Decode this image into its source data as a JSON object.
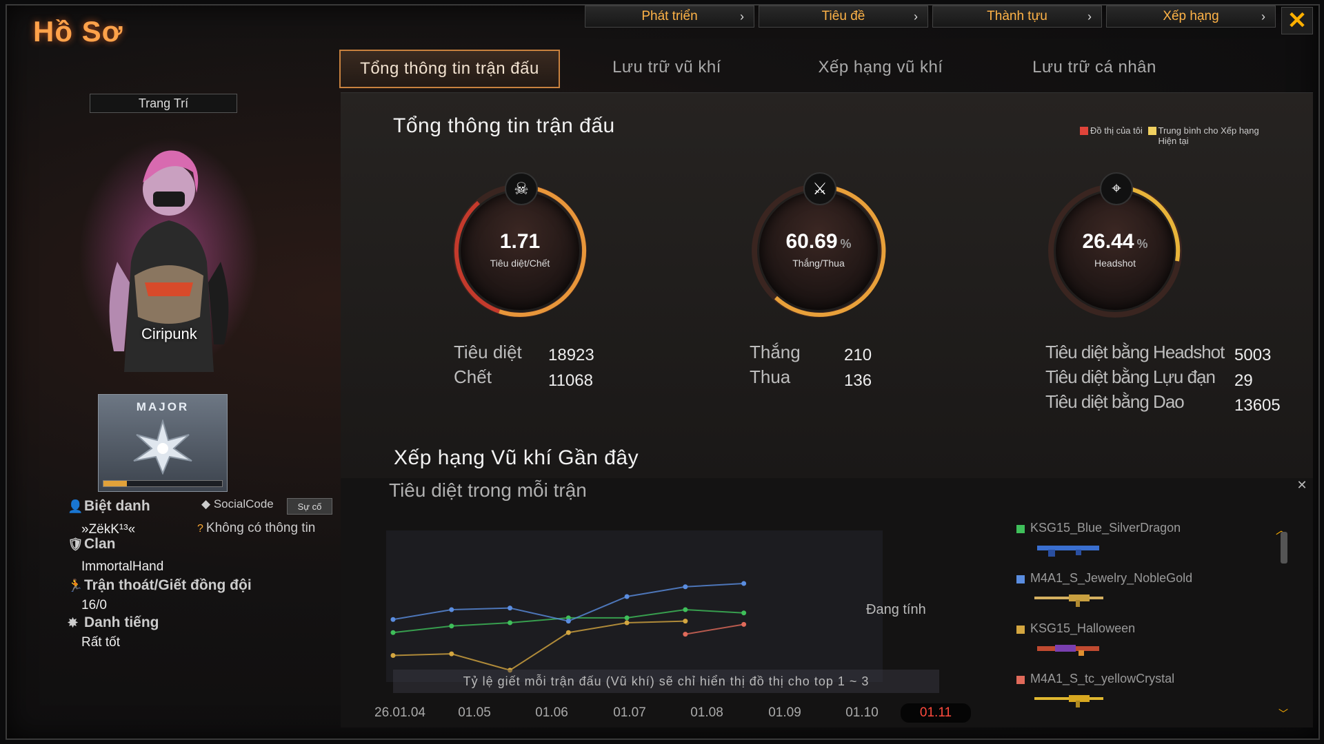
{
  "window": {
    "title": "Hồ Sơ",
    "close_icon": "close-icon"
  },
  "top_nav": [
    {
      "label": "Phát triển"
    },
    {
      "label": "Tiêu đề"
    },
    {
      "label": "Thành tựu"
    },
    {
      "label": "Xếp hạng"
    }
  ],
  "tabs": [
    {
      "label": "Tổng thông tin trận đấu",
      "active": true
    },
    {
      "label": "Lưu trữ vũ khí"
    },
    {
      "label": "Xếp hạng vũ khí"
    },
    {
      "label": "Lưu trữ cá nhân"
    }
  ],
  "left": {
    "decoration_label": "Trang Trí",
    "character_name": "Ciripunk",
    "rank": {
      "name": "MAJOR"
    },
    "nickname_label": "Biệt danh",
    "nickname_value": "»ZëkK¹³«",
    "social_label": "SocialCode",
    "social_button": "Sự cố",
    "social_value": "Không có thông tin",
    "clan_label": "Clan",
    "clan_value": "ImmortalHand",
    "escape_label": "Trận thoát/Giết đồng đội",
    "escape_value": "16/0",
    "reputation_label": "Danh tiếng",
    "reputation_value": "Rất tốt"
  },
  "summary": {
    "title": "Tổng thông tin trận đấu",
    "legend": {
      "mine": "Đồ thị của tôi",
      "avg": "Trung bình cho Xếp hạng Hiện tại",
      "mine_color": "#e0443a",
      "avg_color": "#f0d060"
    },
    "gauges": [
      {
        "value": "1.71",
        "unit": "",
        "label": "Tiêu diệt/Chết",
        "icon": "skull-icon"
      },
      {
        "value": "60.69",
        "unit": "%",
        "label": "Thắng/Thua",
        "icon": "crossed-swords-icon"
      },
      {
        "value": "26.44",
        "unit": "%",
        "label": "Headshot",
        "icon": "crosshair-icon"
      }
    ],
    "kd": {
      "kills_label": "Tiêu diệt",
      "kills": "18923",
      "deaths_label": "Chết",
      "deaths": "11068"
    },
    "wl": {
      "wins_label": "Thắng",
      "wins": "210",
      "losses_label": "Thua",
      "losses": "136"
    },
    "special": {
      "headshot_label": "Tiêu diệt bằng Headshot",
      "headshot": "5003",
      "grenade_label": "Tiêu diệt bằng Lựu đạn",
      "grenade": "29",
      "knife_label": "Tiêu diệt bằng Dao",
      "knife": "13605"
    }
  },
  "recent": {
    "title": "Xếp hạng Vũ khí Gần đây",
    "subtitle": "Tiêu diệt trong mỗi trận",
    "calculating": "Đang tính",
    "note": "Tỷ lệ giết mỗi trận đấu (Vũ khí) sẽ chỉ hiển thị đồ thị cho top 1 ~ 3",
    "weapons": [
      {
        "name": "KSG15_Blue_SilverDragon",
        "color": "#3fbf5a"
      },
      {
        "name": "M4A1_S_Jewelry_NobleGold",
        "color": "#5a8de0"
      },
      {
        "name": "KSG15_Halloween",
        "color": "#d4a640"
      },
      {
        "name": "M4A1_S_tc_yellowCrystal",
        "color": "#e06a5a"
      }
    ]
  },
  "chart_data": {
    "type": "line",
    "categories": [
      "26.01.04",
      "01.05",
      "01.06",
      "01.07",
      "01.08",
      "01.09",
      "01.10",
      "01.11"
    ],
    "selected": "01.11",
    "series": [
      {
        "name": "KSG15_Blue_SilverDragon",
        "color": "#3fbf5a",
        "values": [
          2.6,
          3.0,
          3.2,
          3.5,
          3.5,
          4.0,
          3.8,
          null
        ]
      },
      {
        "name": "M4A1_S_Jewelry_NobleGold",
        "color": "#5a8de0",
        "values": [
          3.4,
          4.0,
          4.1,
          3.3,
          4.8,
          5.4,
          5.6,
          null
        ]
      },
      {
        "name": "KSG15_Halloween",
        "color": "#d4a640",
        "values": [
          1.2,
          1.3,
          0.3,
          2.6,
          3.2,
          3.3,
          null,
          null
        ]
      },
      {
        "name": "M4A1_S_tc_yellowCrystal",
        "color": "#e06a5a",
        "values": [
          null,
          null,
          null,
          null,
          null,
          2.5,
          3.1,
          null
        ]
      }
    ],
    "ylim": [
      0,
      8
    ]
  }
}
